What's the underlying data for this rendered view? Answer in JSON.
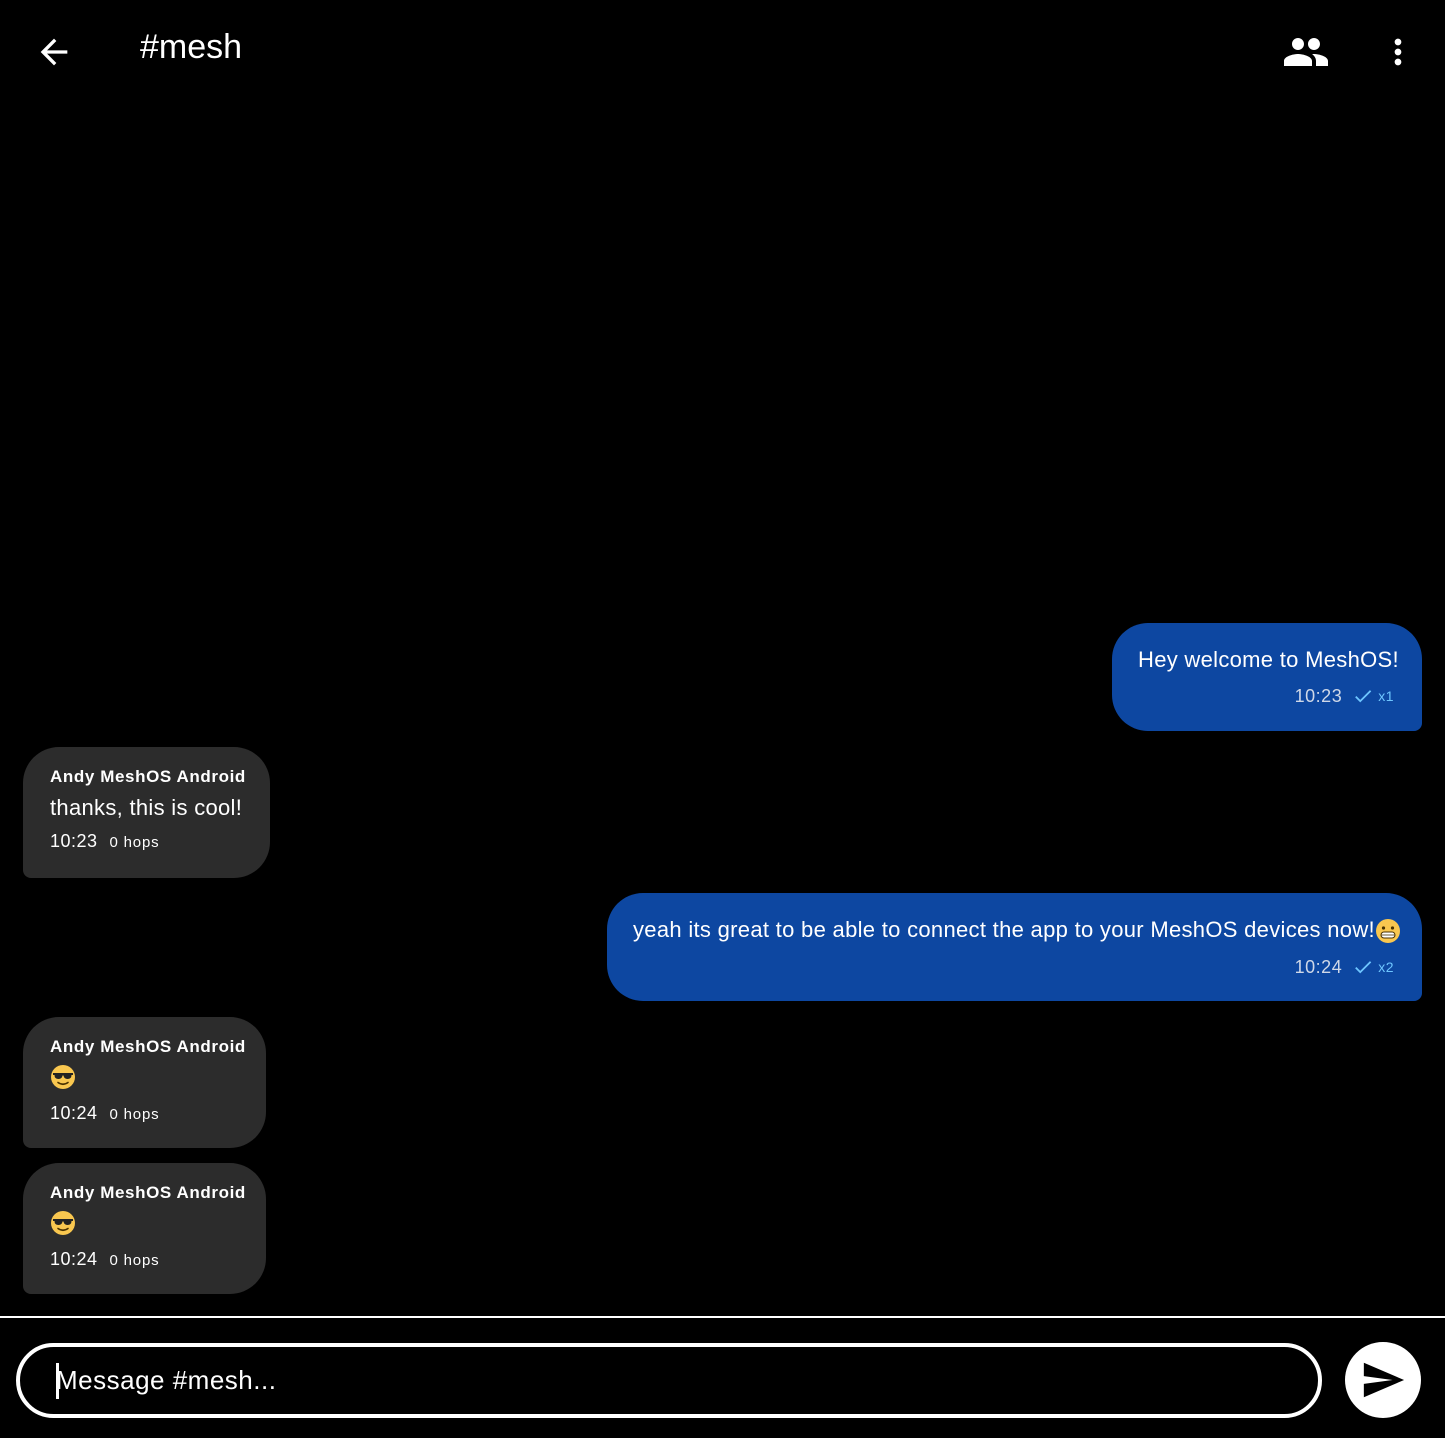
{
  "header": {
    "title": "#mesh",
    "back_icon": "arrow-back-icon",
    "members_icon": "people-icon",
    "menu_icon": "more-vert-icon"
  },
  "messages": [
    {
      "direction": "outgoing",
      "text": "Hey welcome to MeshOS!",
      "time": "10:23",
      "ack_count": "x1"
    },
    {
      "direction": "incoming",
      "sender": "Andy MeshOS Android",
      "text": "thanks, this is cool!",
      "time": "10:23",
      "hops": "0 hops"
    },
    {
      "direction": "outgoing",
      "text": "yeah its great to be able to connect the app to your MeshOS devices now!",
      "emoji": "grinning-face",
      "time": "10:24",
      "ack_count": "x2"
    },
    {
      "direction": "incoming",
      "sender": "Andy MeshOS Android",
      "emoji": "smiling-face-with-sunglasses",
      "time": "10:24",
      "hops": "0 hops"
    },
    {
      "direction": "incoming",
      "sender": "Andy MeshOS Android",
      "emoji": "smiling-face-with-sunglasses",
      "time": "10:24",
      "hops": "0 hops"
    }
  ],
  "composer": {
    "placeholder": "Message #mesh...",
    "value": "",
    "send_icon": "send-icon"
  },
  "colors": {
    "background": "#000000",
    "outgoing_bubble": "#0d47a1",
    "incoming_bubble": "#2c2c2c",
    "ack_check": "#6ec6ff"
  }
}
